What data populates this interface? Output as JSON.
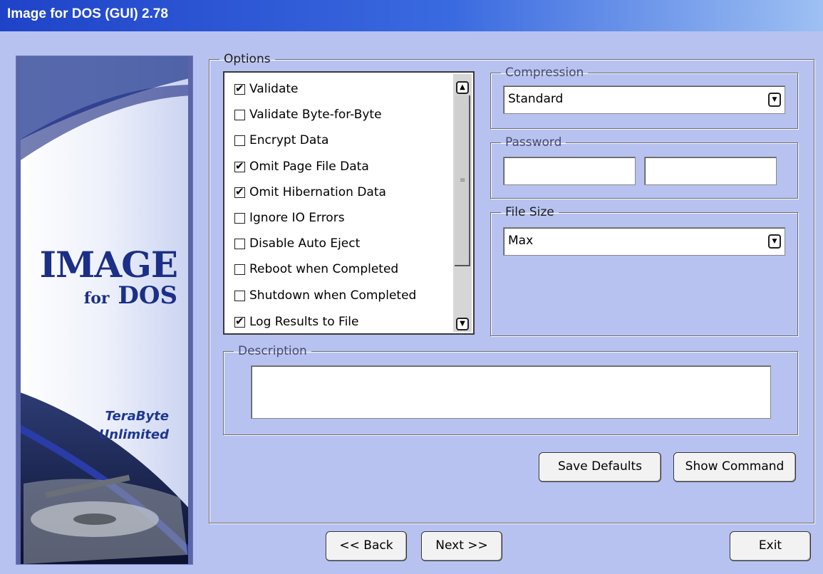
{
  "window": {
    "title": "Image for DOS (GUI) 2.78"
  },
  "banner": {
    "title_main": "IMAGE",
    "title_for": "for",
    "title_dos": "DOS",
    "vendor_line1": "TeraByte",
    "vendor_line2": "Unlimited"
  },
  "options": {
    "legend": "Options",
    "items": [
      {
        "label": "Validate",
        "checked": true
      },
      {
        "label": "Validate Byte-for-Byte",
        "checked": false
      },
      {
        "label": "Encrypt Data",
        "checked": false
      },
      {
        "label": "Omit Page File Data",
        "checked": true
      },
      {
        "label": "Omit Hibernation Data",
        "checked": true
      },
      {
        "label": "Ignore IO Errors",
        "checked": false
      },
      {
        "label": "Disable Auto Eject",
        "checked": false
      },
      {
        "label": "Reboot when Completed",
        "checked": false
      },
      {
        "label": "Shutdown when Completed",
        "checked": false
      },
      {
        "label": "Log Results to File",
        "checked": true
      }
    ]
  },
  "compression": {
    "legend": "Compression",
    "value": "Standard"
  },
  "password": {
    "legend": "Password",
    "value1": "",
    "value2": ""
  },
  "file_size": {
    "legend": "File Size",
    "value": "Max"
  },
  "description": {
    "legend": "Description",
    "value": ""
  },
  "buttons": {
    "save_defaults": "Save Defaults",
    "show_command": "Show Command",
    "back": "<< Back",
    "next": "Next >>",
    "exit": "Exit"
  },
  "colors": {
    "window_bg": "#b7c2f0",
    "title_bar": "#1f43c8",
    "banner_text": "#1b2f86"
  }
}
